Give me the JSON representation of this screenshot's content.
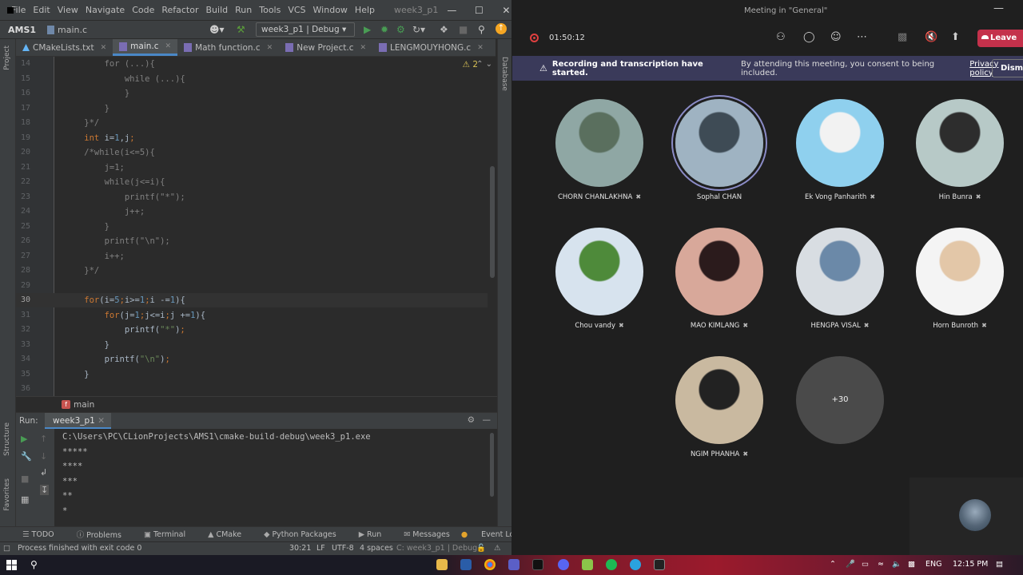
{
  "ide": {
    "menu": [
      "File",
      "Edit",
      "View",
      "Navigate",
      "Code",
      "Refactor",
      "Build",
      "Run",
      "Tools",
      "VCS",
      "Window",
      "Help"
    ],
    "project_title": "week3_p1",
    "nav_project": "AMS1",
    "nav_file": "main.c",
    "run_config": "week3_p1 | Debug",
    "tabs": [
      {
        "label": "CMakeLists.txt",
        "icon": "cmake-icon"
      },
      {
        "label": "main.c",
        "icon": "c-file-icon"
      },
      {
        "label": "Math function.c",
        "icon": "c-file-icon"
      },
      {
        "label": "New Project.c",
        "icon": "c-file-icon"
      },
      {
        "label": "LENGMOUYHONG.c",
        "icon": "c-file-icon"
      }
    ],
    "left_strip": [
      "Project",
      "Structure",
      "Favorites"
    ],
    "right_strip": [
      "Database"
    ],
    "warnings": "2",
    "lines": [
      {
        "n": "14",
        "segs": [
          [
            "c-com",
            "        for (...){"
          ]
        ]
      },
      {
        "n": "15",
        "segs": [
          [
            "c-com",
            "            while (...){"
          ]
        ]
      },
      {
        "n": "16",
        "segs": [
          [
            "c-com",
            "            }"
          ]
        ]
      },
      {
        "n": "17",
        "segs": [
          [
            "c-com",
            "        }"
          ]
        ]
      },
      {
        "n": "18",
        "segs": [
          [
            "c-com",
            "    }*/"
          ]
        ]
      },
      {
        "n": "19",
        "segs": [
          [
            "c-kw",
            "    int "
          ],
          [
            "c-id",
            "i="
          ],
          [
            "c-num",
            "1"
          ],
          [
            "c-id",
            ","
          ],
          [
            "c-id",
            "j"
          ],
          [
            "c-kw",
            ";"
          ]
        ]
      },
      {
        "n": "20",
        "segs": [
          [
            "c-com",
            "    /*while(i<=5){"
          ]
        ]
      },
      {
        "n": "21",
        "segs": [
          [
            "c-com",
            "        j=1;"
          ]
        ]
      },
      {
        "n": "22",
        "segs": [
          [
            "c-com",
            "        while(j<=i){"
          ]
        ]
      },
      {
        "n": "23",
        "segs": [
          [
            "c-com",
            "            printf(\"*\");"
          ]
        ]
      },
      {
        "n": "24",
        "segs": [
          [
            "c-com",
            "            j++;"
          ]
        ]
      },
      {
        "n": "25",
        "segs": [
          [
            "c-com",
            "        }"
          ]
        ]
      },
      {
        "n": "26",
        "segs": [
          [
            "c-com",
            "        printf(\"\\n\");"
          ]
        ]
      },
      {
        "n": "27",
        "segs": [
          [
            "c-com",
            "        i++;"
          ]
        ]
      },
      {
        "n": "28",
        "segs": [
          [
            "c-com",
            "    }*/"
          ]
        ]
      },
      {
        "n": "29",
        "segs": [
          [
            "c-id",
            ""
          ]
        ]
      },
      {
        "n": "30",
        "cur": true,
        "segs": [
          [
            "c-kw",
            "    for"
          ],
          [
            "c-id",
            "(i="
          ],
          [
            "c-num",
            "5"
          ],
          [
            "c-kw",
            ";"
          ],
          [
            "c-id",
            "i>="
          ],
          [
            "c-num",
            "1"
          ],
          [
            "c-kw",
            ";"
          ],
          [
            "c-id",
            "i -="
          ],
          [
            "c-num",
            "1"
          ],
          [
            "c-id",
            "){"
          ]
        ]
      },
      {
        "n": "31",
        "segs": [
          [
            "c-kw",
            "        for"
          ],
          [
            "c-id",
            "(j="
          ],
          [
            "c-num",
            "1"
          ],
          [
            "c-kw",
            ";"
          ],
          [
            "c-id",
            "j<=i"
          ],
          [
            "c-kw",
            ";"
          ],
          [
            "c-id",
            "j +="
          ],
          [
            "c-num",
            "1"
          ],
          [
            "c-id",
            "){"
          ]
        ]
      },
      {
        "n": "32",
        "segs": [
          [
            "c-fn",
            "            printf("
          ],
          [
            "c-str",
            "\"*\""
          ],
          [
            "c-id",
            ")"
          ],
          [
            "c-kw",
            ";"
          ]
        ]
      },
      {
        "n": "33",
        "segs": [
          [
            "c-id",
            "        }"
          ]
        ]
      },
      {
        "n": "34",
        "segs": [
          [
            "c-fn",
            "        printf("
          ],
          [
            "c-str",
            "\"\\n\""
          ],
          [
            "c-id",
            ")"
          ],
          [
            "c-kw",
            ";"
          ]
        ]
      },
      {
        "n": "35",
        "segs": [
          [
            "c-id",
            "    }"
          ]
        ]
      },
      {
        "n": "36",
        "segs": [
          [
            "c-id",
            ""
          ]
        ]
      }
    ],
    "breadcrumb_fn": "main",
    "run_label": "Run:",
    "run_tab": "week3_p1",
    "console": [
      "C:\\Users\\PC\\CLionProjects\\AMS1\\cmake-build-debug\\week3_p1.exe",
      "*****",
      "****",
      "***",
      "**",
      "*"
    ],
    "toolwindows": [
      "TODO",
      "Problems",
      "Terminal",
      "CMake",
      "Python Packages",
      "Run",
      "Messages"
    ],
    "event_log": "Event Log",
    "status": {
      "message": "Process finished with exit code 0",
      "position": "30:21",
      "line_sep": "LF",
      "encoding": "UTF-8",
      "indent": "4 spaces",
      "context": "C: week3_p1 | Debug"
    }
  },
  "teams": {
    "window_title": "Meeting in \"General\"",
    "timer": "01:50:12",
    "leave_label": "Leave",
    "banner_bold": "Recording and transcription have started.",
    "banner_text": "By attending this meeting, you consent to being included.",
    "banner_link": "Privacy policy",
    "dismiss": "Dismiss",
    "participants": [
      {
        "name": "CHORN CHANLAKHNA",
        "muted": true,
        "colors": [
          "#8fa7a4",
          "#5a6f5e"
        ]
      },
      {
        "name": "Sophal CHAN",
        "muted": false,
        "speaking": true,
        "colors": [
          "#9fb3c2",
          "#3e4b55"
        ]
      },
      {
        "name": "Ek Vong Panharith",
        "muted": true,
        "colors": [
          "#8fd0ee",
          "#f2f2f2"
        ]
      },
      {
        "name": "Hin Bunra",
        "muted": true,
        "colors": [
          "#b7c9c7",
          "#2d2d2d"
        ]
      },
      {
        "name": "Chou vandy",
        "muted": true,
        "colors": [
          "#d7e3ee",
          "#4e8a3a"
        ]
      },
      {
        "name": "MAO KIMLANG",
        "muted": true,
        "colors": [
          "#d8a89a",
          "#2b1b1c"
        ]
      },
      {
        "name": "HENGPA VISAL",
        "muted": true,
        "colors": [
          "#d8dde2",
          "#6b89a8"
        ]
      },
      {
        "name": "Horn Bunroth",
        "muted": true,
        "colors": [
          "#f4f4f4",
          "#e3c7a8"
        ]
      },
      {
        "name": "NGIM PHANHA",
        "muted": true,
        "colors": [
          "#c9b9a0",
          "#222222"
        ]
      }
    ],
    "more_count": "+30"
  },
  "taskbar": {
    "lang": "ENG",
    "time": "12:15 PM"
  }
}
